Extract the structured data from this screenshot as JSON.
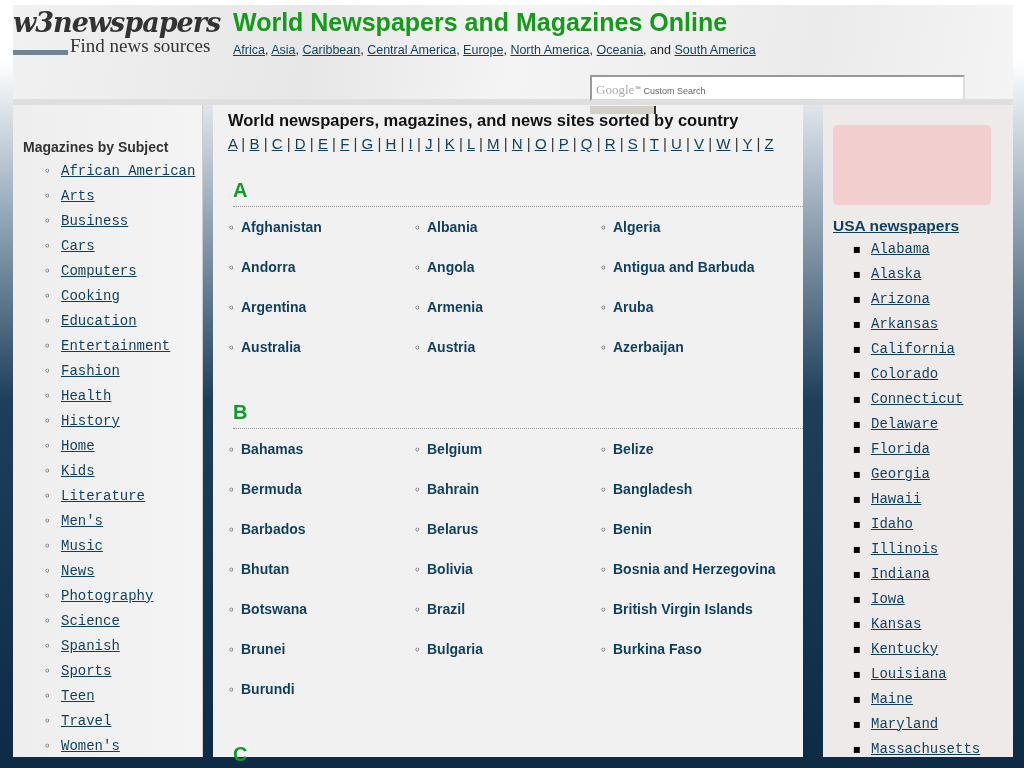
{
  "header": {
    "logo": "w3newspapers",
    "tagline": "Find news sources",
    "title": "World Newspapers and Magazines Online",
    "regions": [
      "Africa",
      "Asia",
      "Caribbean",
      "Central America",
      "Europe",
      "North America",
      "Oceania",
      "South America"
    ],
    "regions_separator": ",",
    "regions_joiner": "and",
    "search": {
      "brand": "Google",
      "brand_mark": "™",
      "placeholder": "Custom Search"
    }
  },
  "left_sidebar": {
    "heading": "Magazines by Subject",
    "marker": "◦",
    "items": [
      "African American",
      "Arts",
      "Business",
      "Cars",
      "Computers",
      "Cooking",
      "Education",
      "Entertainment",
      "Fashion",
      "Health",
      "History",
      "Home",
      "Kids",
      "Literature",
      "Men's",
      "Music",
      "News",
      "Photography",
      "Science",
      "Spanish",
      "Sports",
      "Teen",
      "Travel",
      "Women's"
    ]
  },
  "main": {
    "heading": "World newspapers, magazines, and news sites sorted by country",
    "letter_separator": "|",
    "country_marker": "◦",
    "letters": [
      "A",
      "B",
      "C",
      "D",
      "E",
      "F",
      "G",
      "H",
      "I",
      "J",
      "K",
      "L",
      "M",
      "N",
      "O",
      "P",
      "Q",
      "R",
      "S",
      "T",
      "U",
      "V",
      "W",
      "Y",
      "Z"
    ],
    "sections": [
      {
        "letter": "A",
        "countries": [
          "Afghanistan",
          "Albania",
          "Algeria",
          "Andorra",
          "Angola",
          "Antigua and Barbuda",
          "Argentina",
          "Armenia",
          "Aruba",
          "Australia",
          "Austria",
          "Azerbaijan"
        ]
      },
      {
        "letter": "B",
        "countries": [
          "Bahamas",
          "Belgium",
          "Belize",
          "Bermuda",
          "Bahrain",
          "Bangladesh",
          "Barbados",
          "Belarus",
          "Benin",
          "Bhutan",
          "Bolivia",
          "Bosnia and Herzegovina",
          "Botswana",
          "Brazil",
          "British Virgin Islands",
          "Brunei",
          "Bulgaria",
          "Burkina Faso",
          "Burundi"
        ]
      },
      {
        "letter": "C"
      }
    ]
  },
  "right_sidebar": {
    "heading": "USA newspapers",
    "marker": "▪",
    "items": [
      "Alabama",
      "Alaska",
      "Arizona",
      "Arkansas",
      "California",
      "Colorado",
      "Connecticut",
      "Delaware",
      "Florida",
      "Georgia",
      "Hawaii",
      "Idaho",
      "Illinois",
      "Indiana",
      "Iowa",
      "Kansas",
      "Kentucky",
      "Louisiana",
      "Maine",
      "Maryland",
      "Massachusetts"
    ]
  }
}
